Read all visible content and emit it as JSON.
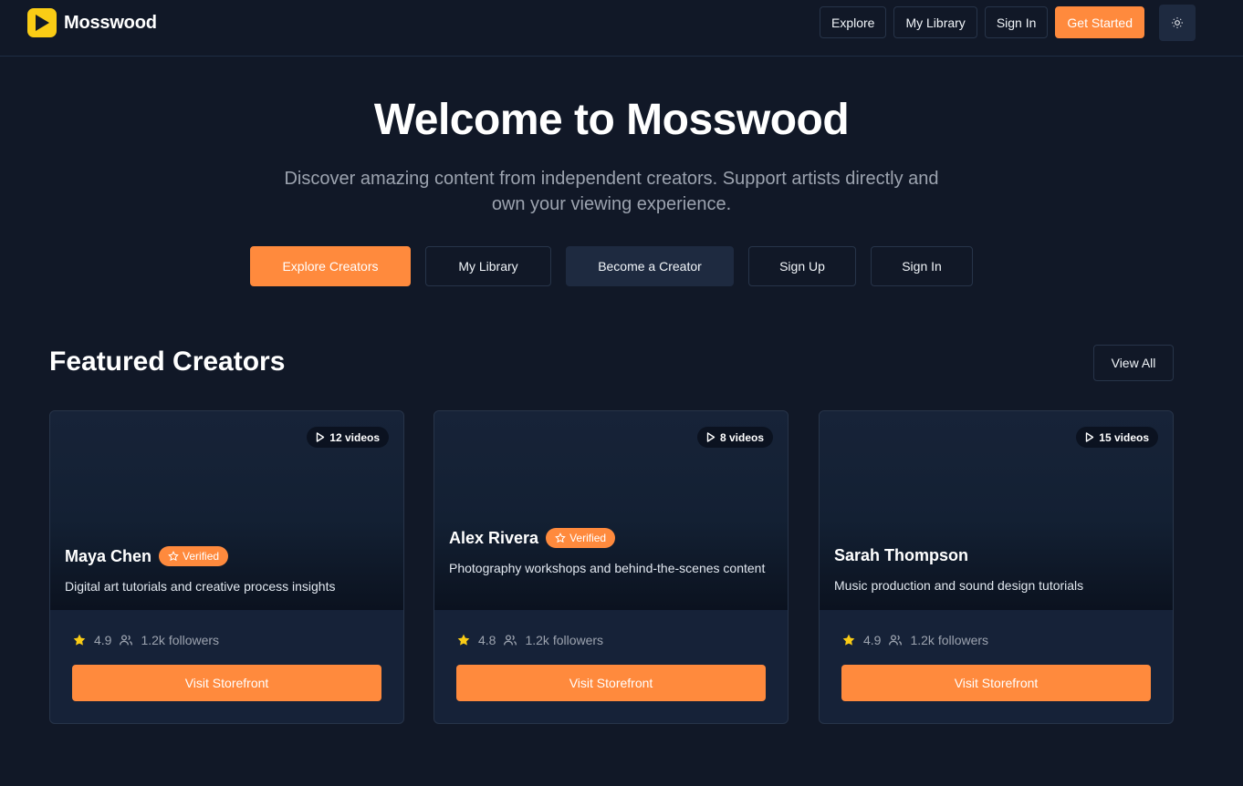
{
  "header": {
    "brand": "Mosswood",
    "nav": [
      "Explore",
      "My Library",
      "Sign In"
    ],
    "cta": "Get Started",
    "theme_icon": "sun-icon"
  },
  "hero": {
    "title": "Welcome to Mosswood",
    "subtitle": "Discover amazing content from independent creators. Support artists directly and own your viewing experience.",
    "actions": [
      "Explore Creators",
      "My Library",
      "Become a Creator",
      "Sign Up",
      "Sign In"
    ]
  },
  "featured": {
    "title": "Featured Creators",
    "view_all": "View All",
    "creators": [
      {
        "name": "Maya Chen",
        "verified": "Verified",
        "videos": "12 videos",
        "description": "Digital art tutorials and creative process insights",
        "rating": "4.9",
        "followers": "1.2k followers",
        "button": "Visit Storefront"
      },
      {
        "name": "Alex Rivera",
        "verified": "Verified",
        "videos": "8 videos",
        "description": "Photography workshops and behind-the-scenes content",
        "rating": "4.8",
        "followers": "1.2k followers",
        "button": "Visit Storefront"
      },
      {
        "name": "Sarah Thompson",
        "verified": "",
        "videos": "15 videos",
        "description": "Music production and sound design tutorials",
        "rating": "4.9",
        "followers": "1.2k followers",
        "button": "Visit Storefront"
      }
    ]
  },
  "colors": {
    "background": "#111827",
    "accent": "#ff8a3d",
    "logo": "#facc15",
    "star": "#facc15"
  }
}
